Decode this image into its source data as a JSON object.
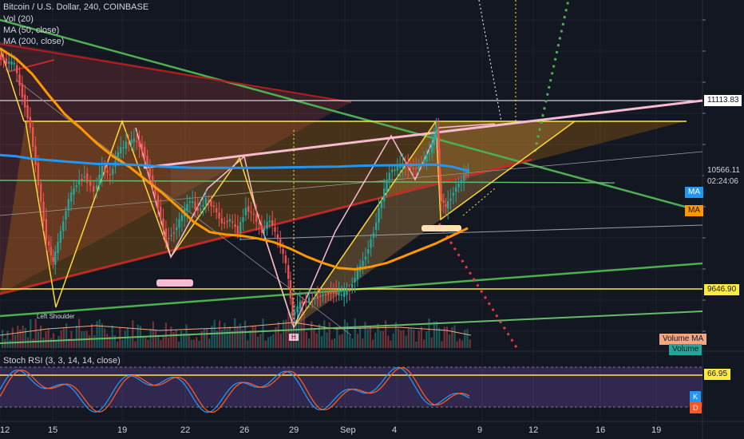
{
  "header": {
    "symbol": "Bitcoin / U.S. Dollar, 240, COINBASE",
    "studies": [
      "Vol (20)",
      "MA (50, close)",
      "MA (200, close)"
    ]
  },
  "price_tags": {
    "top_line": "11113.83",
    "last_price": "10566.11",
    "countdown": "02:24:06",
    "ma50_tag": "MA",
    "ma200_tag": "MA",
    "support": "9646.90",
    "volume_ma": "Volume MA",
    "volume": "Volume"
  },
  "annotations": {
    "left_shoulder": "Left Shoulder",
    "head": "H"
  },
  "stoch": {
    "title": "Stoch RSI (3, 3, 14, 14, close)",
    "level": "66.95",
    "k_tag": "K",
    "d_tag": "D"
  },
  "time_axis": [
    "12",
    "15",
    "19",
    "22",
    "26",
    "29",
    "Sep",
    "4",
    "9",
    "12",
    "16",
    "19"
  ],
  "colors": {
    "background": "#131722",
    "up": "#26a69a",
    "down": "#ef5350",
    "ma50": "#ff9800",
    "ma200": "#2196f3",
    "yellow": "#ffeb3b",
    "pink": "#f8bbd0",
    "green": "#4caf50"
  },
  "chart_data": {
    "type": "line",
    "title": "Bitcoin / U.S. Dollar, 240, COINBASE",
    "y_levels": [
      11113.83,
      10566.11,
      9646.9
    ],
    "series": [
      {
        "name": "MA (50, close)",
        "values": [
          11520,
          11440,
          11320,
          11160,
          11010,
          10900,
          10780,
          10680,
          10600,
          10500,
          10400,
          10290,
          10170,
          10090,
          10070,
          10060,
          10040,
          10010,
          9960,
          9900,
          9850,
          9810,
          9800,
          9820,
          9850,
          9900,
          9950,
          10000,
          10060,
          10120
        ]
      },
      {
        "name": "MA (200, close)",
        "values": [
          10690,
          10680,
          10660,
          10650,
          10640,
          10630,
          10620,
          10620,
          10615,
          10610,
          10600,
          10595,
          10590,
          10590,
          10590,
          10590,
          10590,
          10592,
          10594,
          10596,
          10598,
          10600,
          10605,
          10608,
          10610,
          10612,
          10614,
          10615,
          10600,
          10566
        ]
      }
    ],
    "stoch_level": 66.95
  }
}
